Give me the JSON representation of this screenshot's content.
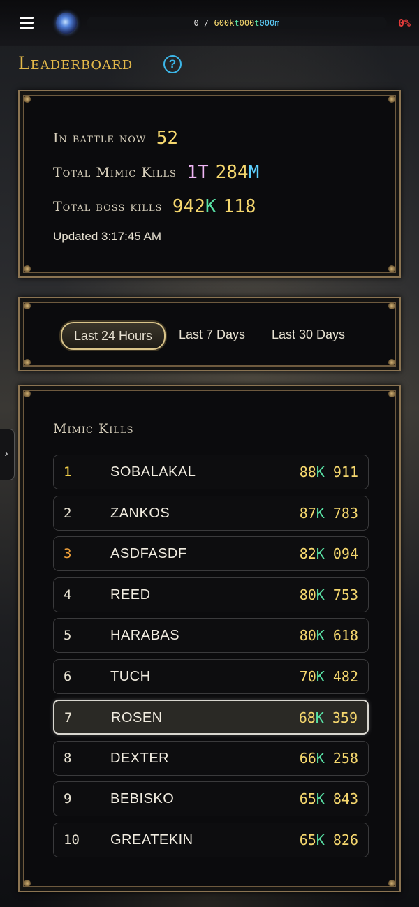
{
  "topbar": {
    "progress_current": "0",
    "progress_sep": " / ",
    "progress_total_1": "600k",
    "progress_total_2": "t",
    "progress_total_3": "000",
    "progress_total_4": "t",
    "progress_total_5": "000m",
    "progress_fraction": 0,
    "percent": "0%"
  },
  "page": {
    "title": "Leaderboard",
    "help_icon": "?"
  },
  "stats": {
    "in_battle_label": "In battle now",
    "in_battle_value": "52",
    "mimic_label": "Total Mimic Kills",
    "mimic_value_a": "1T",
    "mimic_value_b": "284",
    "mimic_value_c": "M",
    "boss_label": "Total boss kills",
    "boss_value_a": "942",
    "boss_value_b": "K",
    "boss_value_c": "118",
    "updated": "Updated 3:17:45 AM"
  },
  "tabs": [
    {
      "label": "Last 24 Hours",
      "active": true
    },
    {
      "label": "Last 7 Days",
      "active": false
    },
    {
      "label": "Last 30 Days",
      "active": false
    }
  ],
  "board": {
    "title": "Mimic Kills",
    "rows": [
      {
        "rank": "1",
        "name": "SOBALAKAL",
        "score_a": "88",
        "score_k": "K",
        "score_b": "911"
      },
      {
        "rank": "2",
        "name": "ZANKOS",
        "score_a": "87",
        "score_k": "K",
        "score_b": "783"
      },
      {
        "rank": "3",
        "name": "ASDFASDF",
        "score_a": "82",
        "score_k": "K",
        "score_b": "094"
      },
      {
        "rank": "4",
        "name": "REED",
        "score_a": "80",
        "score_k": "K",
        "score_b": "753"
      },
      {
        "rank": "5",
        "name": "HARABAS",
        "score_a": "80",
        "score_k": "K",
        "score_b": "618"
      },
      {
        "rank": "6",
        "name": "TUCH",
        "score_a": "70",
        "score_k": "K",
        "score_b": "482"
      },
      {
        "rank": "7",
        "name": "ROSEN",
        "score_a": "68",
        "score_k": "K",
        "score_b": "359"
      },
      {
        "rank": "8",
        "name": "DEXTER",
        "score_a": "66",
        "score_k": "K",
        "score_b": "258"
      },
      {
        "rank": "9",
        "name": "BEBISKO",
        "score_a": "65",
        "score_k": "K",
        "score_b": "843"
      },
      {
        "rank": "10",
        "name": "GREATEKIN",
        "score_a": "65",
        "score_k": "K",
        "score_b": "826"
      }
    ]
  },
  "side_tab": {
    "label": "›"
  },
  "colors": {
    "gold": "#f5d76e",
    "cyan": "#5ed1ff",
    "green": "#58e0a4",
    "red": "#e23b3b",
    "frame": "#8b7452"
  },
  "icons": [
    "menu-icon",
    "avatar-orb-icon",
    "help-icon",
    "chevron-right-icon"
  ]
}
